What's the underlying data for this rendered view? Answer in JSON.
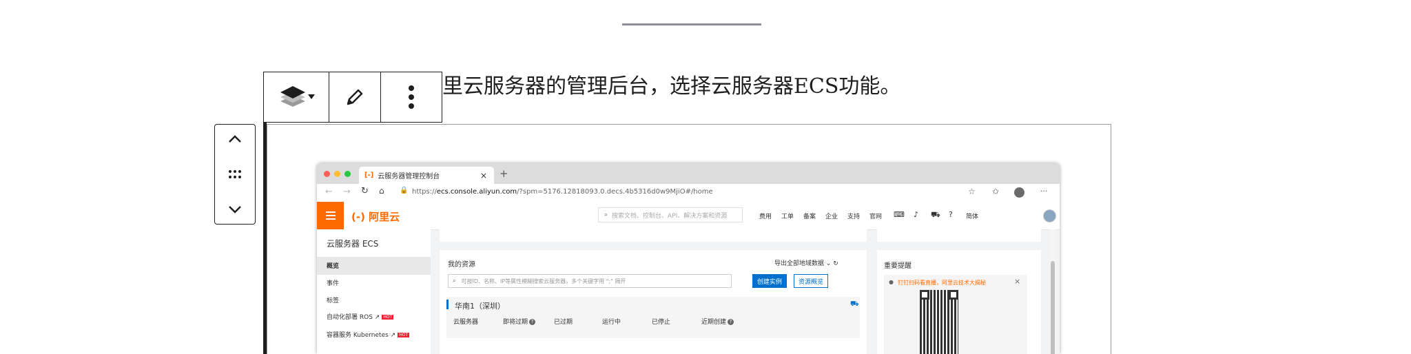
{
  "editor": {
    "paragraph_text": "里云服务器的管理后台，选择云服务器ECS功能。"
  },
  "browser": {
    "tab_title": "云服务器管理控制台",
    "tab_close": "×",
    "new_tab": "+",
    "url_prefix": "https://",
    "url_host": "ecs.console.aliyun.com",
    "url_path": "/?spm=5176.12818093.0.decs.4b5316d0w9MjiO#/home",
    "more": "···"
  },
  "console": {
    "logo_text": "阿里云",
    "search_placeholder": "搜索文档、控制台、API、解决方案和资源",
    "nav": [
      "费用",
      "工单",
      "备案",
      "企业",
      "支持",
      "官网"
    ],
    "lang": "简体",
    "sidebar": {
      "title": "云服务器 ECS",
      "items": [
        "概览",
        "事件",
        "标签",
        "自动化部署 ROS",
        "容器服务 Kubernetes"
      ],
      "hot_badge": "HOT"
    },
    "resources": {
      "title": "我的资源",
      "export": "导出全部地域数据",
      "search_placeholder": "可按ID、名称、IP等属性模糊搜索云服务器，多个关键字用 \";\" 隔开",
      "create_button": "创建实例",
      "overview_button": "资源概览",
      "region": "华南1（深圳）",
      "columns": [
        "云服务器",
        "即将过期",
        "已过期",
        "运行中",
        "已停止",
        "近期创建"
      ]
    },
    "reminder": {
      "title": "重要提醒",
      "notice": "钉钉扫码看直播，阿里云技术大揭秘",
      "close": "×"
    }
  }
}
